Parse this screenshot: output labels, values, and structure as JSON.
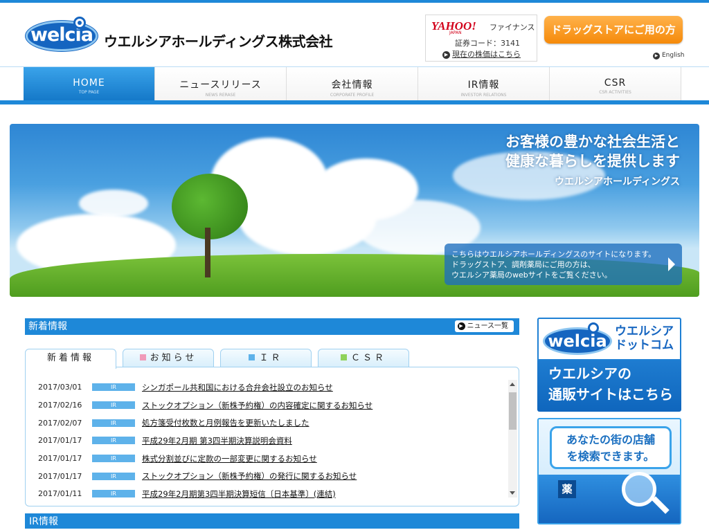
{
  "header": {
    "logo_text": "welcia",
    "company_name": "ウエルシアホールディングス株式会社",
    "yahoo": {
      "brand": "YAHOO!",
      "brand_sub": "JAPAN",
      "finance": "ファイナンス",
      "stock_code": "証券コード：3141",
      "link": "現在の株価はこちら"
    },
    "drugstore_button": "ドラッグストアにご用の方",
    "english_link": "English"
  },
  "nav": {
    "items": [
      {
        "jp": "HOME",
        "en": "TOP PAGE",
        "active": true
      },
      {
        "jp": "ニュースリリース",
        "en": "NEWS RERASE",
        "active": false
      },
      {
        "jp": "会社情報",
        "en": "CORPORATE PROFILE",
        "active": false
      },
      {
        "jp": "IR情報",
        "en": "INVESTOR RELATIONS",
        "active": false
      },
      {
        "jp": "CSR",
        "en": "CSR ACTIVITIES",
        "active": false
      }
    ]
  },
  "hero": {
    "slogan_line1": "お客様の豊かな社会生活と",
    "slogan_line2": "健康な暮らしを提供します",
    "slogan_company": "ウエルシアホールディングス",
    "box_line1": "こちらはウエルシアホールディングスのサイトになります。",
    "box_line2": "ドラッグストア、調剤薬局にご用の方は、",
    "box_line3": "ウエルシア薬局のwebサイトをご覧ください。"
  },
  "news": {
    "heading": "新着情報",
    "list_button": "ニュース一覧",
    "tabs": [
      {
        "label": "新着情報",
        "color": ""
      },
      {
        "label": "お知らせ",
        "color": "#f09ab8"
      },
      {
        "label": "ＩＲ",
        "color": "#5eb2ea"
      },
      {
        "label": "ＣＳＲ",
        "color": "#8fd35a"
      }
    ],
    "items": [
      {
        "date": "2017/03/01",
        "tag": "IR",
        "title": "シンガポール共和国における合弁会社設立のお知らせ"
      },
      {
        "date": "2017/02/16",
        "tag": "IR",
        "title": "ストックオプション（新株予約権）の内容確定に関するお知らせ"
      },
      {
        "date": "2017/02/07",
        "tag": "IR",
        "title": "処方箋受付枚数と月例報告を更新いたしました"
      },
      {
        "date": "2017/01/17",
        "tag": "IR",
        "title": "平成29年2月期 第3四半期決算説明会資料"
      },
      {
        "date": "2017/01/17",
        "tag": "IR",
        "title": "株式分割並びに定款の一部変更に関するお知らせ"
      },
      {
        "date": "2017/01/17",
        "tag": "IR",
        "title": "ストックオプション（新株予約権）の発行に関するお知らせ"
      },
      {
        "date": "2017/01/11",
        "tag": "IR",
        "title": "平成29年2月期第3四半期決算短信〔日本基準〕(連結)"
      }
    ]
  },
  "ir": {
    "heading": "IR情報"
  },
  "side": {
    "banner1_logo": "welcia",
    "banner1_title_line1": "ウエルシア",
    "banner1_title_line2": "ドットコム",
    "banner1_text_line1": "ウエルシアの",
    "banner1_text_line2": "通販サイトはこちら",
    "banner2_line1": "あなたの街の店舗",
    "banner2_line2": "を検索できます。",
    "banner2_kusuri": "薬"
  },
  "colors": {
    "brand_blue": "#1e88d8",
    "orange": "#f58a0a",
    "yahoo_red": "#d2001a"
  }
}
